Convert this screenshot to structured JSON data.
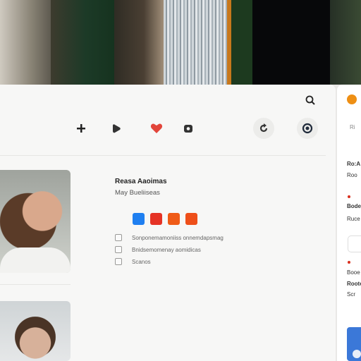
{
  "window": {
    "header_search_icon": "search-icon"
  },
  "toolbar": {
    "tools": [
      {
        "name": "add-icon",
        "color": "#222222"
      },
      {
        "name": "play-icon",
        "color": "#333333"
      },
      {
        "name": "heart-icon",
        "color": "#e2453a"
      },
      {
        "name": "camera-icon",
        "color": "#333333"
      },
      {
        "name": "refresh-icon",
        "color": "#333333"
      },
      {
        "name": "target-icon",
        "color": "#1f2a3a"
      }
    ]
  },
  "profile": {
    "name": "Reasa Aaoimas",
    "subtitle": "May Bueliiseas",
    "swatches": [
      "#1f7ff0",
      "#e53225",
      "#ef5b17",
      "#ee4f1a"
    ],
    "rows": [
      "Sonponemamoniiss onnemdapsmag",
      "Bnidsemomenay aomidicas",
      "Scanos"
    ]
  },
  "side_panel": {
    "accent": "#ee8f14",
    "items": [
      "Ro:A",
      "Roo",
      "Bode",
      "Ruce",
      "Booe",
      "Roote",
      "Scr",
      "Ri"
    ]
  }
}
